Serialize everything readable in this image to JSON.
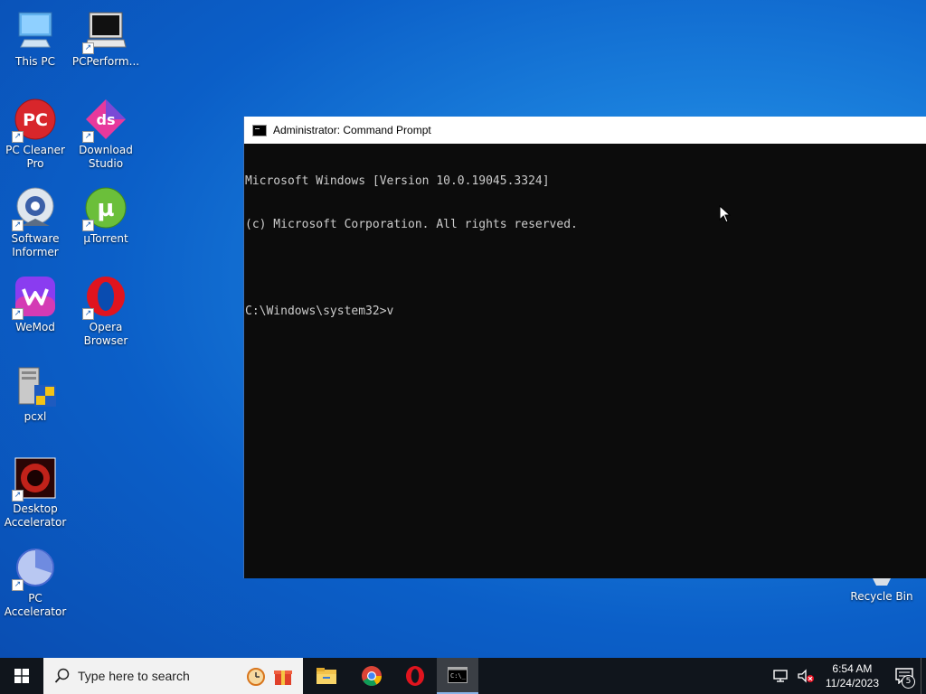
{
  "desktop": {
    "icons": [
      {
        "label": "This PC",
        "icon": "this-pc-icon"
      },
      {
        "label": "PCPerform...",
        "icon": "pcperformer-icon"
      },
      {
        "label": "PC Cleaner Pro",
        "icon": "pc-cleaner-icon"
      },
      {
        "label": "Download Studio",
        "icon": "download-studio-icon"
      },
      {
        "label": "Software Informer",
        "icon": "software-informer-icon"
      },
      {
        "label": "µTorrent",
        "icon": "utorrent-icon"
      },
      {
        "label": "WeMod",
        "icon": "wemod-icon"
      },
      {
        "label": "Opera Browser",
        "icon": "opera-icon"
      },
      {
        "label": "pcxl",
        "icon": "pcxl-icon"
      },
      {
        "label": "Desktop Accelerator",
        "icon": "desktop-accelerator-icon"
      },
      {
        "label": "PC Accelerator",
        "icon": "pc-accelerator-icon"
      },
      {
        "label": "Recycle Bin",
        "icon": "recycle-bin-icon"
      }
    ]
  },
  "cmd_window": {
    "title": "Administrator: Command Prompt",
    "lines": [
      "Microsoft Windows [Version 10.0.19045.3324]",
      "(c) Microsoft Corporation. All rights reserved.",
      "",
      "C:\\Windows\\system32>v"
    ]
  },
  "taskbar": {
    "search_placeholder": "Type here to search",
    "time": "6:54 AM",
    "date": "11/24/2023",
    "notification_count": "5",
    "pinned": [
      "file-explorer-icon",
      "chrome-icon",
      "opera-icon",
      "cmd-icon"
    ]
  },
  "colors": {
    "taskbar_bg": "#10151c",
    "console_bg": "#0c0c0c",
    "console_text": "#cccccc"
  }
}
